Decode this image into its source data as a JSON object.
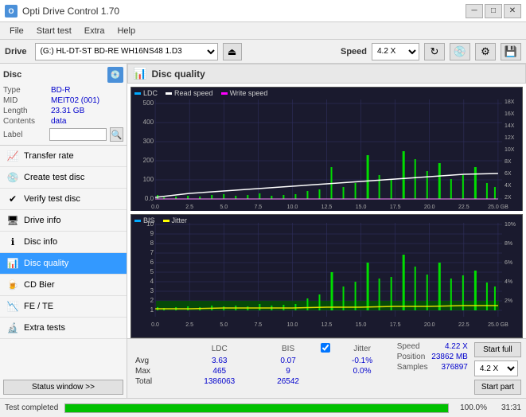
{
  "titleBar": {
    "icon": "O",
    "title": "Opti Drive Control 1.70",
    "minimize": "─",
    "maximize": "□",
    "close": "✕"
  },
  "menuBar": {
    "items": [
      "File",
      "Start test",
      "Extra",
      "Help"
    ]
  },
  "driveBar": {
    "label": "Drive",
    "driveValue": "(G:) HL-DT-ST BD-RE  WH16NS48 1.D3",
    "speedLabel": "Speed",
    "speedValue": "4.2 X"
  },
  "disc": {
    "header": "Disc",
    "type_label": "Type",
    "type_val": "BD-R",
    "mid_label": "MID",
    "mid_val": "MEIT02 (001)",
    "length_label": "Length",
    "length_val": "23.31 GB",
    "contents_label": "Contents",
    "contents_val": "data",
    "label_label": "Label"
  },
  "navigation": {
    "items": [
      {
        "id": "transfer-rate",
        "label": "Transfer rate",
        "icon": "📈"
      },
      {
        "id": "create-test-disc",
        "label": "Create test disc",
        "icon": "💿"
      },
      {
        "id": "verify-test-disc",
        "label": "Verify test disc",
        "icon": "✔"
      },
      {
        "id": "drive-info",
        "label": "Drive info",
        "icon": "🖥"
      },
      {
        "id": "disc-info",
        "label": "Disc info",
        "icon": "ℹ"
      },
      {
        "id": "disc-quality",
        "label": "Disc quality",
        "icon": "📊",
        "active": true
      },
      {
        "id": "cd-bier",
        "label": "CD Bier",
        "icon": "🍺"
      },
      {
        "id": "fe-te",
        "label": "FE / TE",
        "icon": "📉"
      },
      {
        "id": "extra-tests",
        "label": "Extra tests",
        "icon": "🔬"
      }
    ],
    "statusBtn": "Status window >>"
  },
  "discQuality": {
    "title": "Disc quality",
    "legend1": "LDC",
    "legend2": "Read speed",
    "legend3": "Write speed",
    "legend4": "BIS",
    "legend5": "Jitter"
  },
  "stats": {
    "col_ldc": "LDC",
    "col_bis": "BIS",
    "col_jitter": "Jitter",
    "row_avg_label": "Avg",
    "row_avg_ldc": "3.63",
    "row_avg_bis": "0.07",
    "row_avg_jitter": "-0.1%",
    "row_max_label": "Max",
    "row_max_ldc": "465",
    "row_max_bis": "9",
    "row_max_jitter": "0.0%",
    "row_total_label": "Total",
    "row_total_ldc": "1386063",
    "row_total_bis": "26542",
    "speed_label": "Speed",
    "speed_val": "4.22 X",
    "position_label": "Position",
    "position_val": "23862 MB",
    "samples_label": "Samples",
    "samples_val": "376897",
    "jitter_checked": true,
    "start_full_btn": "Start full",
    "start_part_btn": "Start part",
    "speed_dropdown": "4.2 X"
  },
  "statusBar": {
    "text": "Test completed",
    "progress": 100,
    "progressText": "100.0%",
    "time": "31:31"
  },
  "chart1": {
    "yLabels_left": [
      "500",
      "400",
      "300",
      "200",
      "100",
      "0.0"
    ],
    "yLabels_right": [
      "18X",
      "16X",
      "14X",
      "12X",
      "10X",
      "8X",
      "6X",
      "4X",
      "2X"
    ],
    "xLabels": [
      "0.0",
      "2.5",
      "5.0",
      "7.5",
      "10.0",
      "12.5",
      "15.0",
      "17.5",
      "20.0",
      "22.5",
      "25.0 GB"
    ]
  },
  "chart2": {
    "yLabels_left": [
      "10",
      "9",
      "8",
      "7",
      "6",
      "5",
      "4",
      "3",
      "2",
      "1"
    ],
    "yLabels_right": [
      "10%",
      "8%",
      "6%",
      "4%",
      "2%"
    ],
    "xLabels": [
      "0.0",
      "2.5",
      "5.0",
      "7.5",
      "10.0",
      "12.5",
      "15.0",
      "17.5",
      "20.0",
      "22.5",
      "25.0 GB"
    ]
  }
}
